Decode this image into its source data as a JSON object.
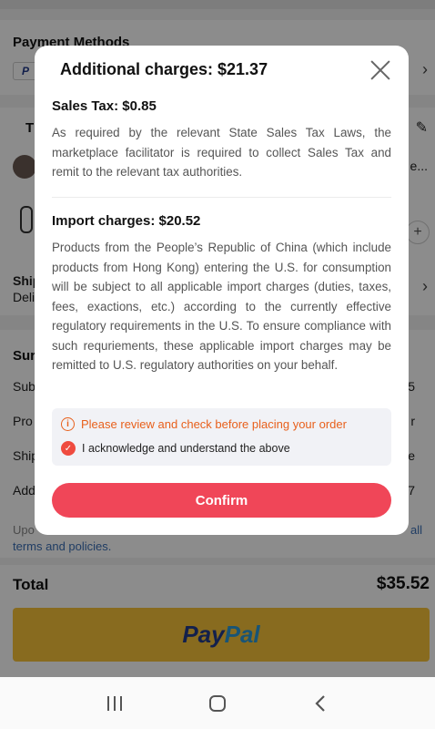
{
  "background": {
    "payment_methods_title": "Payment Methods",
    "items_title_partial": "T",
    "item_text_partial": "e...",
    "shipping_title_partial": "Ship",
    "shipping_sub_partial": "Deli",
    "summary_title_partial": "Sur",
    "summary_rows": [
      {
        "label": "Sub",
        "value": "5"
      },
      {
        "label": "Pro",
        "value": "r"
      },
      {
        "label": "Ship",
        "value": "e"
      },
      {
        "label": "Add",
        "value": "7"
      }
    ],
    "policy_text_partial": "Upo",
    "policy_link_end": "all",
    "policy_link": "terms and policies.",
    "total_label": "Total",
    "total_value": "$35.52",
    "paypal_pay": "Pay",
    "paypal_pal": "Pal"
  },
  "modal": {
    "title": "Additional charges: $21.37",
    "sales_tax": {
      "heading": "Sales Tax: $0.85",
      "text": "As required by the relevant State Sales Tax Laws, the marketplace facilitator is required to collect Sales Tax and remit to the relevant tax authorities."
    },
    "import_charges": {
      "heading": "Import charges: $20.52",
      "text": "Products from the People’s Republic of China (which include products from Hong Kong) entering the U.S. for consumption will be subject to all applicable import charges (duties, taxes, fees, exactions, etc.) according to the currently effective regulatory requirements in the U.S. To ensure compliance with such requriements, these applicable import charges may be remitted to U.S. regulatory authorities on your behalf."
    },
    "notice_warning": "Please review and check before placing your order",
    "notice_acknowledge": "I acknowledge and understand the above",
    "confirm_label": "Confirm"
  },
  "colors": {
    "accent": "#f04658",
    "warning": "#e8601c",
    "paypal_button": "#f7c43a"
  }
}
